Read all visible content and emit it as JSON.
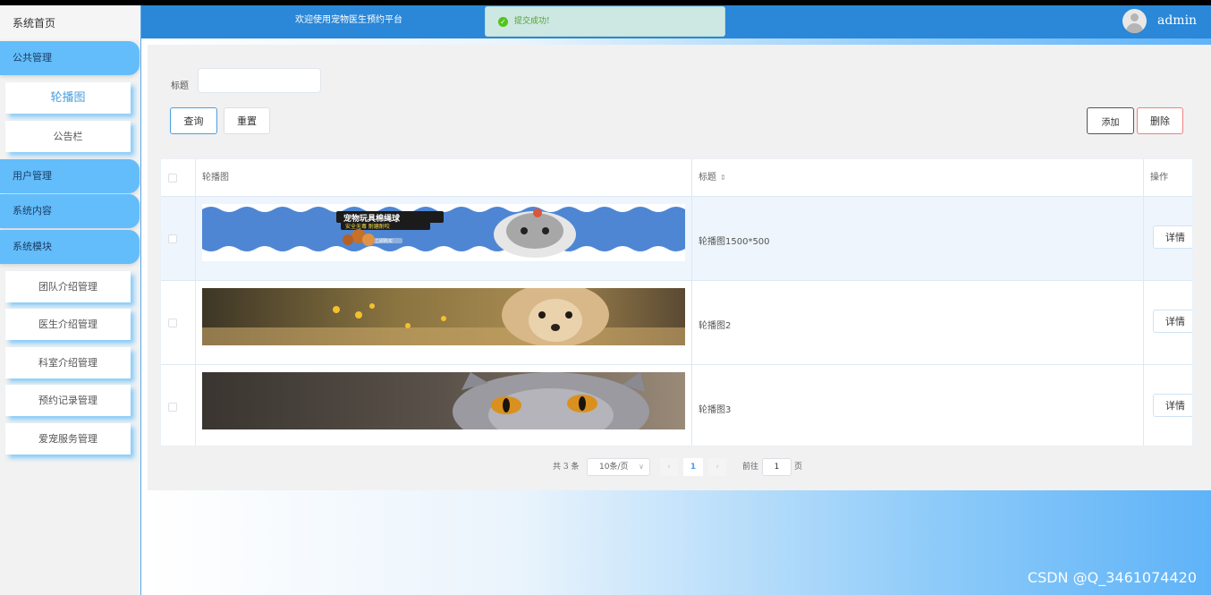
{
  "sidebar": {
    "home": "系统首页",
    "groups": [
      {
        "label": "公共管理"
      },
      {
        "label": "用户管理"
      },
      {
        "label": "系统内容"
      },
      {
        "label": "系统模块"
      }
    ],
    "public_items": [
      "轮播图",
      "公告栏"
    ],
    "module_items": [
      "团队介绍管理",
      "医生介绍管理",
      "科室介绍管理",
      "预约记录管理",
      "爱宠服务管理"
    ]
  },
  "header": {
    "welcome": "欢迎使用宠物医生预约平台",
    "toast": "提交成功!",
    "username": "admin"
  },
  "search": {
    "label": "标题",
    "value": "",
    "query_label": "查询",
    "reset_label": "重置",
    "add_label": "添加",
    "delete_label": "删除"
  },
  "table": {
    "columns": [
      "轮播图",
      "标题",
      "操作"
    ],
    "rows": [
      {
        "title": "轮播图1500*500",
        "action": "详情",
        "banner_text": "宠物玩具棉绳球",
        "banner_sub": "安全无毒 耐磨耐咬",
        "banner_tag": "立即购买"
      },
      {
        "title": "轮播图2",
        "action": "详情"
      },
      {
        "title": "轮播图3",
        "action": "详情"
      }
    ]
  },
  "pagination": {
    "total": "共 3 条",
    "page_size": "10条/页",
    "current": "1",
    "goto_label": "前往",
    "goto_value": "1",
    "unit": "页"
  },
  "watermark": "CSDN @Q_3461074420",
  "colors": {
    "header": "#2b87d7",
    "sidebar_group": "#63bdfa",
    "accent": "#409eff"
  }
}
